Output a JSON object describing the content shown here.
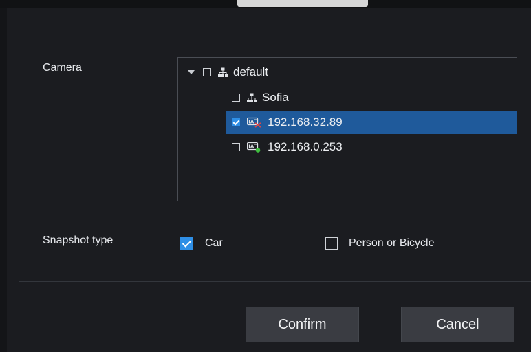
{
  "form": {
    "camera_label": "Camera",
    "snapshot_label": "Snapshot type"
  },
  "tree": {
    "root": {
      "label": "default",
      "checked": false,
      "expanded": true,
      "icon": "network-group-icon"
    },
    "children": [
      {
        "label": "Sofia",
        "checked": false,
        "icon": "network-group-icon"
      },
      {
        "label": "192.168.32.89",
        "checked": true,
        "selected": true,
        "icon": "camera-offline-icon"
      },
      {
        "label": "192.168.0.253",
        "checked": false,
        "icon": "camera-online-icon"
      }
    ]
  },
  "snapshot_types": [
    {
      "label": "Car",
      "checked": true
    },
    {
      "label": "Person or Bicycle",
      "checked": false
    }
  ],
  "buttons": {
    "confirm": "Confirm",
    "cancel": "Cancel"
  },
  "colors": {
    "selection": "#1f5a9b",
    "check_accent": "#2f8fe6",
    "offline": "#e04545",
    "online": "#3fbf3f"
  }
}
